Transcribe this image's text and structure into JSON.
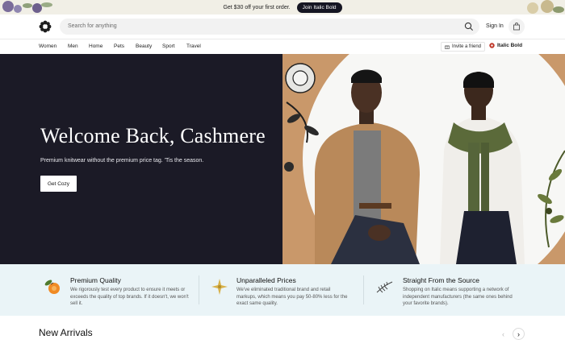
{
  "promo": {
    "text": "Get $30 off your first order.",
    "button": "Join Italic Bold"
  },
  "header": {
    "search_placeholder": "Search for anything",
    "sign_in": "Sign In"
  },
  "nav": {
    "items": [
      "Women",
      "Men",
      "Home",
      "Pets",
      "Beauty",
      "Sport",
      "Travel"
    ],
    "invite": "Invite a friend",
    "brand": "Italic Bold"
  },
  "hero": {
    "title": "Welcome Back, Cashmere",
    "subtitle": "Premium knitwear without the premium price tag. 'Tis the season.",
    "button": "Get Cozy"
  },
  "features": [
    {
      "title": "Premium Quality",
      "body": "We rigorously test every product to ensure it meets or exceeds the quality of top brands. If it doesn't, we won't sell it.",
      "icon": "orange-icon"
    },
    {
      "title": "Unparalleled Prices",
      "body": "We've eliminated traditional brand and retail markups, which means you pay 50-80% less for the exact same quality.",
      "icon": "star-icon"
    },
    {
      "title": "Straight From the Source",
      "body": "Shopping on Italic means supporting a network of independent manufacturers (the same ones behind your favorite brands).",
      "icon": "fern-icon"
    }
  ],
  "new_arrivals": {
    "title": "New Arrivals"
  },
  "colors": {
    "hero_dark": "#1b1a26",
    "hero_tan": "#c9986a",
    "features_bg": "#eaf4f7",
    "promo_bg": "#f1efe6"
  }
}
